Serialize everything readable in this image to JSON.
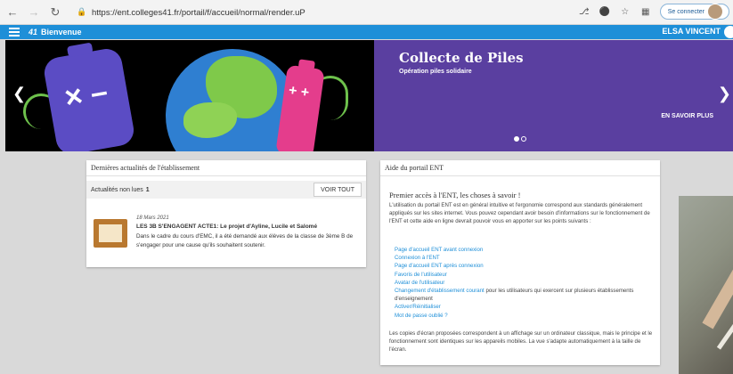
{
  "browser": {
    "url": "https://ent.colleges41.fr/portail/f/accueil/normal/render.uP",
    "connect_label": "Se connecter"
  },
  "topbar": {
    "logo": "41",
    "welcome": "Bienvenue",
    "user": "ELSA VINCENT"
  },
  "banner": {
    "title": "Collecte de Piles",
    "subtitle": "Opération piles solidaire",
    "more": "EN SAVOIR PLUS",
    "face1": "× –",
    "face2": "+ +"
  },
  "news": {
    "header": "Dernières actualités de l'établissement",
    "unread_label": "Actualités non lues",
    "unread_count": "1",
    "see_all": "VOIR TOUT",
    "item": {
      "date": "18 Mars 2021",
      "title": "LES 3B S'ENGAGENT ACTE1: Le projet d'Ayline, Lucile et Salomé",
      "text": "Dans le cadre du cours d'EMC, il a été demandé aux élèves de la classe de 3ème B de s'engager pour une cause qu'ils souhaitent soutenir."
    }
  },
  "help": {
    "header": "Aide du portail ENT",
    "title": "Premier accès à l'ENT, les choses à savoir !",
    "intro": "L'utilisation du portail ENT est en général intuitive et l'ergonomie correspond aux standards généralement appliqués sur les sites internet. Vous pouvez cependant avoir besoin d'informations sur le fonctionnement de l'ENT et cette aide en ligne devrait pouvoir vous en apporter sur les points suivants :",
    "links": [
      "Page d'accueil ENT avant connexion",
      "Connexion à l'ENT",
      "Page d'accueil ENT après connexion",
      "Favoris de l'utilisateur",
      "Avatar de l'utilisateur",
      "Changement d'établissement courant",
      "Activer/Réinitialiser",
      "Mot de passe oublié ?"
    ],
    "link6_suffix": " pour les utilisateurs qui exercent sur plusieurs établissements d'enseignement",
    "footer": "Les copies d'écran proposées correspondent à un affichage sur un ordinateur classique, mais le principe et le fonctionnement sont identiques sur les appareils mobiles. La vue s'adapte automatiquement à la taille de l'écran."
  }
}
